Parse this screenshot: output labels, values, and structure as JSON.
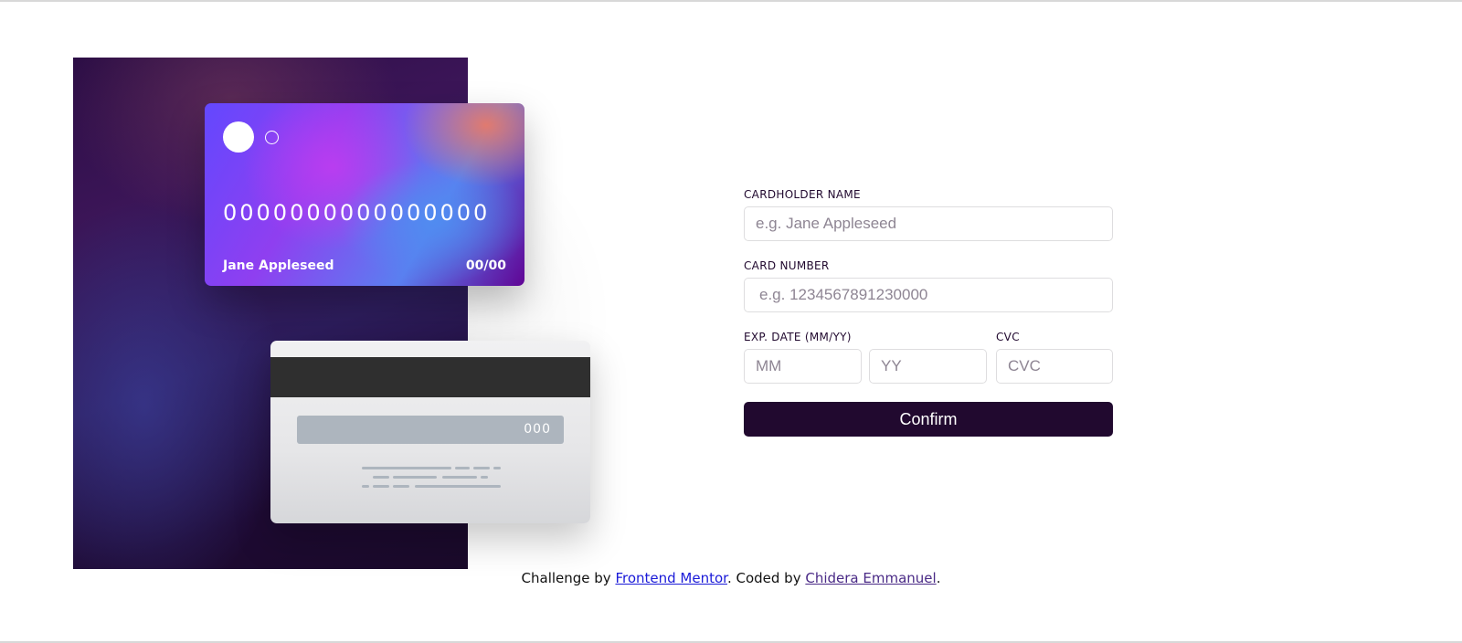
{
  "card_front": {
    "number": "0000000000000000",
    "name": "Jane Appleseed",
    "expiry": "00/00"
  },
  "card_back": {
    "cvc": "000"
  },
  "form": {
    "name_label": "CARDHOLDER NAME",
    "name_placeholder": "e.g. Jane Appleseed",
    "number_label": "CARD NUMBER",
    "number_placeholder": "e.g. 1234567891230000",
    "exp_label": "EXP. DATE (MM/YY)",
    "month_placeholder": "MM",
    "year_placeholder": "YY",
    "cvc_label": "CVC",
    "cvc_placeholder": "CVC",
    "confirm_label": "Confirm"
  },
  "footer": {
    "prefix": "Challenge by ",
    "challenge_link": "Frontend Mentor",
    "middle": ". Coded by ",
    "author_link": "Chidera Emmanuel",
    "suffix": "."
  },
  "colors": {
    "primary_dark": "#21092f",
    "input_border": "#dedddf",
    "link_blue": "#1a1ad8"
  }
}
